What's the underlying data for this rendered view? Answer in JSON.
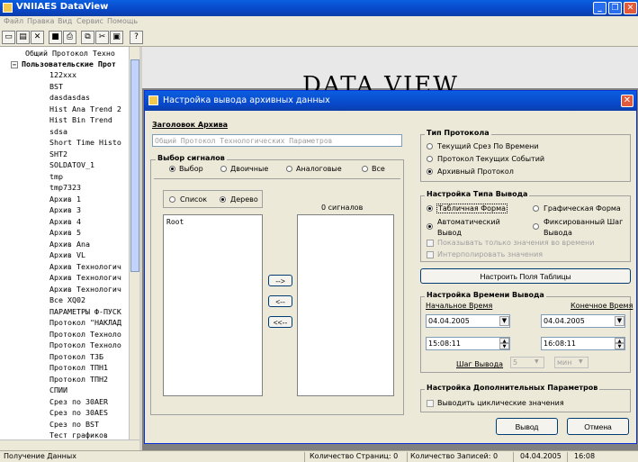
{
  "app": {
    "title": "VNIIAES DataView"
  },
  "menu": [
    "Файл",
    "Правка",
    "Вид",
    "Сервис",
    "Помощь"
  ],
  "toolbar": {
    "icons": [
      "new-doc-icon",
      "properties-icon",
      "delete-icon",
      "save-icon",
      "print-icon",
      "copy-icon",
      "cut-icon",
      "paste-icon",
      "help-icon"
    ]
  },
  "tree": {
    "top_item": "Общий Протокол Техно",
    "group": "Пользовательские Прот",
    "items": [
      "122xxx",
      "BST",
      "dasdasdas",
      "Hist Ana Trend 2",
      "Hist Bin Trend",
      "sdsa",
      "Short Time Histo",
      "SHT2",
      "SOLDATOV_1",
      "tmp",
      "tmp7323",
      "Архив 1",
      "Архив 3",
      "Архив 4",
      "Архив 5",
      "Архив Ana",
      "Архив VL",
      "Архив Технологич",
      "Архив Технологич",
      "Архив Технологич",
      "Все XQ02",
      "ПАРАМЕТРЫ Ф-ПУСК",
      "Протокол \"НАКЛАД",
      "Протокол Техноло",
      "Протокол Техноло",
      "Протокол ТЗБ",
      "Протокол ТПН1",
      "Протокол ТПН2",
      "СПИИ",
      "Срез по 30AER",
      "Срез по 30AES",
      "Срез по BST",
      "Тест графиков"
    ]
  },
  "canvas": {
    "banner": "DATA VIEW"
  },
  "status": {
    "left": "Получение Данных",
    "pages": "Количество Страниц: 0",
    "records": "Количество Записей: 0",
    "date": "04.04.2005",
    "time": "16:08"
  },
  "dialog": {
    "title": "Настройка вывода архивных данных",
    "header_label": "Заголовок Архива",
    "header_value": "Общий Протокол Технологических Параметров",
    "signals": {
      "title": "Выбор сигналов",
      "filter_options": [
        "Выбор",
        "Двоичные",
        "Аналоговые",
        "Все"
      ],
      "filter_selected": "Выбор",
      "view_options": [
        "Список",
        "Дерево"
      ],
      "view_selected": "Дерево",
      "tree_root": "Root",
      "count_label": "0 сигналов",
      "move_buttons": [
        "-->",
        "<--",
        "<<--"
      ]
    },
    "protocol_type": {
      "title": "Тип Протокола",
      "options": [
        "Текущий Срез По Времени",
        "Протокол Текущих Событий",
        "Архивный Протокол"
      ],
      "selected": "Архивный Протокол"
    },
    "output_type": {
      "title": "Настройка Типа Вывода",
      "form_options": [
        "Табличная Форма",
        "Графическая Форма"
      ],
      "form_selected": "Табличная Форма",
      "step_options": [
        "Автоматический Вывод",
        "Фиксированный Шаг Вывода"
      ],
      "step_selected": "Автоматический Вывод",
      "checkbox_values_only": "Показывать только значения во времени",
      "checkbox_interpolate": "Интерполировать значения"
    },
    "table_fields_button": "Настроить Поля Таблицы",
    "output_time": {
      "title": "Настройка Времени Вывода",
      "start_label": "Начальное Время",
      "end_label": "Конечное Время",
      "start_date": "04.04.2005",
      "end_date": "04.04.2005",
      "start_time": "15:08:11",
      "end_time": "16:08:11",
      "step_label": "Шаг Вывода",
      "step_value": "5",
      "step_unit": "мин"
    },
    "extra": {
      "title": "Настройка Дополнительных Параметров",
      "checkbox_cyclic": "Выводить циклические значения"
    },
    "ok_button": "Вывод",
    "cancel_button": "Отмена"
  }
}
